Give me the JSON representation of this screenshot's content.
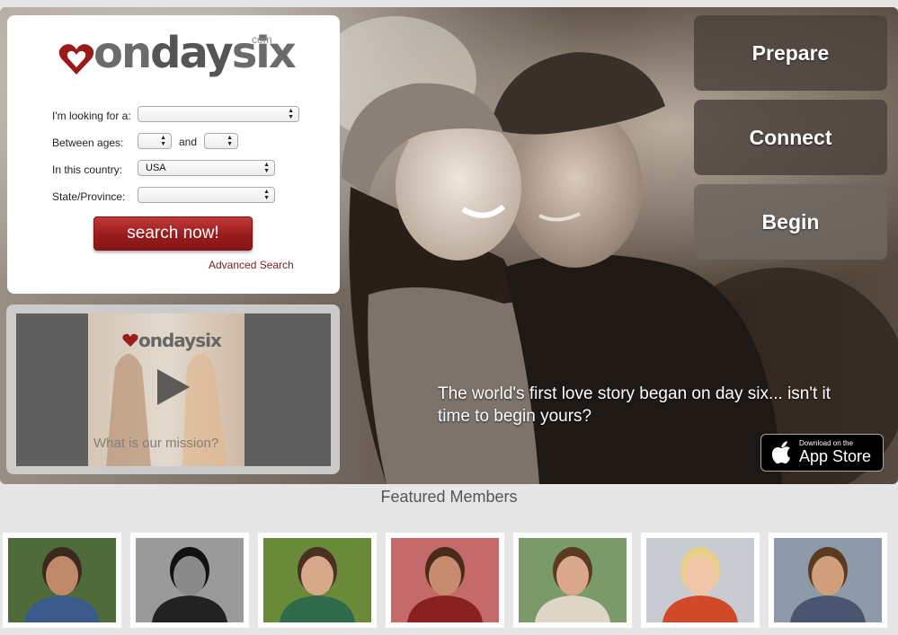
{
  "brand": {
    "name": "ondaysix",
    "logo_on": "on",
    "logo_day": "day",
    "logo_six": "six",
    "logo_com": "com",
    "accent": "#a51c1c"
  },
  "search": {
    "looking_for_label": "I'm looking for a:",
    "looking_for_value": "",
    "ages_label": "Between ages:",
    "age_min": "",
    "age_and": "and",
    "age_max": "",
    "country_label": "In this country:",
    "country_value": "USA",
    "state_label": "State/Province:",
    "state_value": "",
    "button": "search now!",
    "advanced_link": "Advanced Search"
  },
  "video": {
    "logo_text": "ondaysix",
    "caption": "What is our mission?"
  },
  "nav": [
    {
      "label": "Prepare"
    },
    {
      "label": "Connect"
    },
    {
      "label": "Begin"
    }
  ],
  "hero": {
    "tagline": "The world's first love story began on day six... isn't it time to begin yours?"
  },
  "appstore": {
    "small": "Download on the",
    "big": "App Store"
  },
  "featured": {
    "title": "Featured Members",
    "members": [
      {
        "name": "member-1",
        "bg": "#4f6b3a",
        "skin": "#c08a6a",
        "shirt": "#3b5a8a",
        "hair": "#3a2a1e"
      },
      {
        "name": "member-2",
        "bg": "#9a9a9a",
        "skin": "#8a8a8a",
        "shirt": "#222222",
        "hair": "#111111"
      },
      {
        "name": "member-3",
        "bg": "#6a8a3a",
        "skin": "#d7a88a",
        "shirt": "#2f6a4a",
        "hair": "#4a3020"
      },
      {
        "name": "member-4",
        "bg": "#c46a6a",
        "skin": "#c58c70",
        "shirt": "#8a2020",
        "hair": "#4a2a18"
      },
      {
        "name": "member-5",
        "bg": "#7a9a6a",
        "skin": "#d9a88c",
        "shirt": "#e0d6c8",
        "hair": "#5a3a22"
      },
      {
        "name": "member-6",
        "bg": "#c8ccd2",
        "skin": "#efc6a8",
        "shirt": "#d04a2a",
        "hair": "#e8d089"
      },
      {
        "name": "member-7",
        "bg": "#8f9aa8",
        "skin": "#d0a07c",
        "shirt": "#4a5670",
        "hair": "#5a3a20"
      }
    ]
  }
}
